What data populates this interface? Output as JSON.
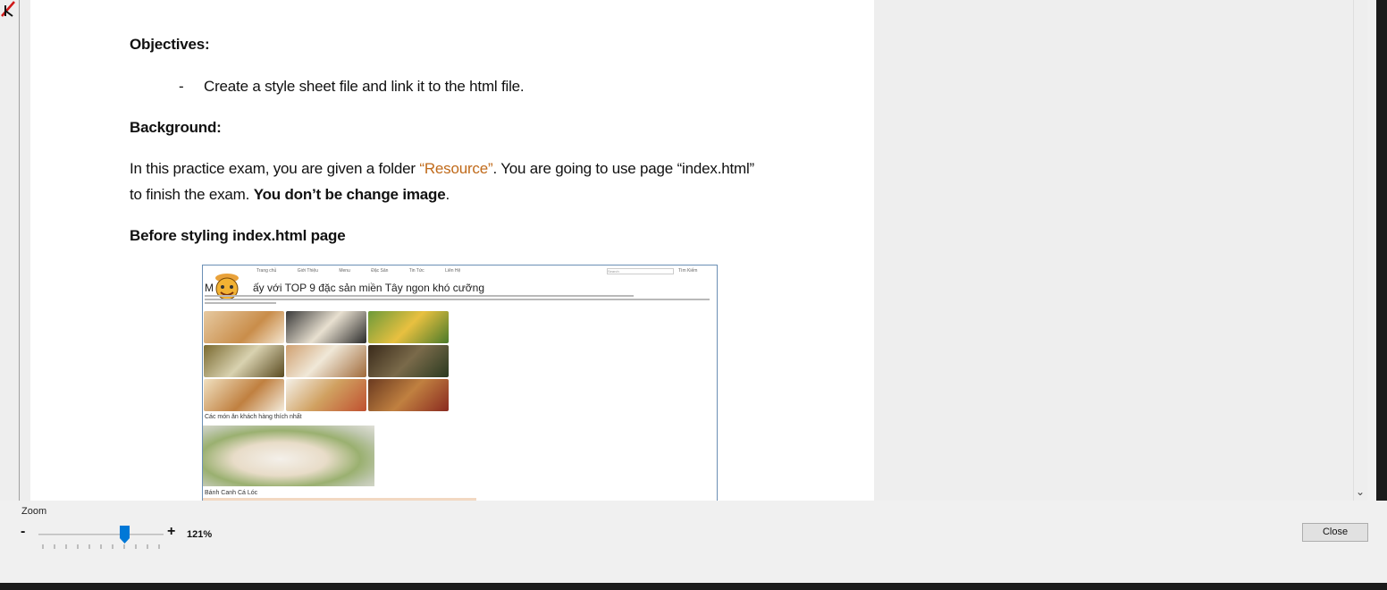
{
  "document": {
    "objectives_heading": "Objectives:",
    "bullet_dash": "-",
    "bullet_text": "Create a style sheet file and link it to the html file.",
    "background_heading": "Background:",
    "para_part1": "In this practice exam, you are given a folder ",
    "para_resource": "“Resource”",
    "para_part2": ". You are going to use page “index.html”",
    "para_line2_part1": "to finish the exam. ",
    "para_line2_bold": "You don’t be change image",
    "para_line2_end": ".",
    "before_heading": "Before styling index.html page"
  },
  "embedded_page": {
    "nav": [
      "Trang chủ",
      "Giới Thiệu",
      "Menu",
      "Đặc Sản",
      "Tin Tức",
      "Liên Hệ"
    ],
    "search_placeholder": "Search",
    "search_button": "Tìm Kiếm",
    "title_prefix": "M",
    "title": "ấy với TOP 9 đặc sản miền Tây ngon khó cưỡng",
    "caption_favorites": "Các món ăn khách hàng thích nhất",
    "caption_dish": "Bánh Canh Cá Lóc"
  },
  "toolbar": {
    "zoom_label": "Zoom",
    "zoom_minus": "-",
    "zoom_plus": "+",
    "zoom_value": "121%",
    "zoom_level_fraction": 0.69,
    "close_label": "Close"
  },
  "colors": {
    "accent_orange": "#c06a1a",
    "slider_thumb": "#0078d7"
  },
  "icons": {
    "scroll_down": "chevron-down-icon"
  }
}
